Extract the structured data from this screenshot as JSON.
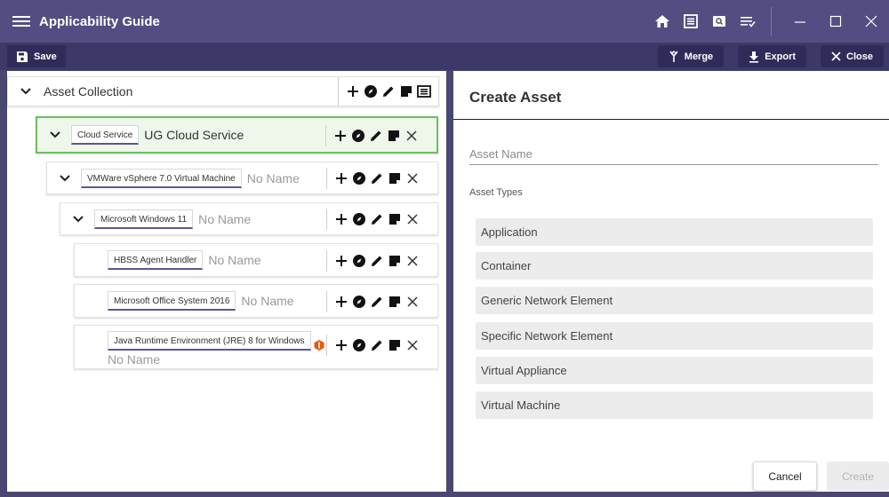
{
  "app": {
    "title": "Applicability Guide"
  },
  "titlebar_icons": [
    "home-icon",
    "list-icon",
    "search-icon",
    "filter-icon"
  ],
  "toolbar": {
    "save_label": "Save",
    "merge_label": "Merge",
    "export_label": "Export",
    "close_label": "Close"
  },
  "tree": {
    "root": {
      "label": "Asset Collection"
    },
    "nodes": [
      {
        "type": "Cloud Service",
        "name": "UG Cloud Service",
        "named": true,
        "selected": true
      },
      {
        "type": "VMWare vSphere 7.0 Virtual Machine",
        "name": "No Name",
        "named": false
      },
      {
        "type": "Microsoft Windows 11",
        "name": "No Name",
        "named": false
      },
      {
        "type": "HBSS Agent Handler",
        "name": "No Name",
        "named": false
      },
      {
        "type": "Microsoft Office System 2016",
        "name": "No Name",
        "named": false
      },
      {
        "type": "Java Runtime Environment (JRE) 8 for Windows",
        "name": "No Name",
        "named": false,
        "warning": true
      }
    ]
  },
  "create_asset": {
    "title": "Create Asset",
    "name_placeholder": "Asset Name",
    "types_label": "Asset Types",
    "types": [
      "Application",
      "Container",
      "Generic Network Element",
      "Specific Network Element",
      "Virtual Appliance",
      "Virtual Machine"
    ],
    "cancel_label": "Cancel",
    "create_label": "Create"
  },
  "colors": {
    "titlebar": "#524e81",
    "toolbar": "#3c3969",
    "selected_border": "#6fbf60",
    "warning": "#e8590c"
  }
}
